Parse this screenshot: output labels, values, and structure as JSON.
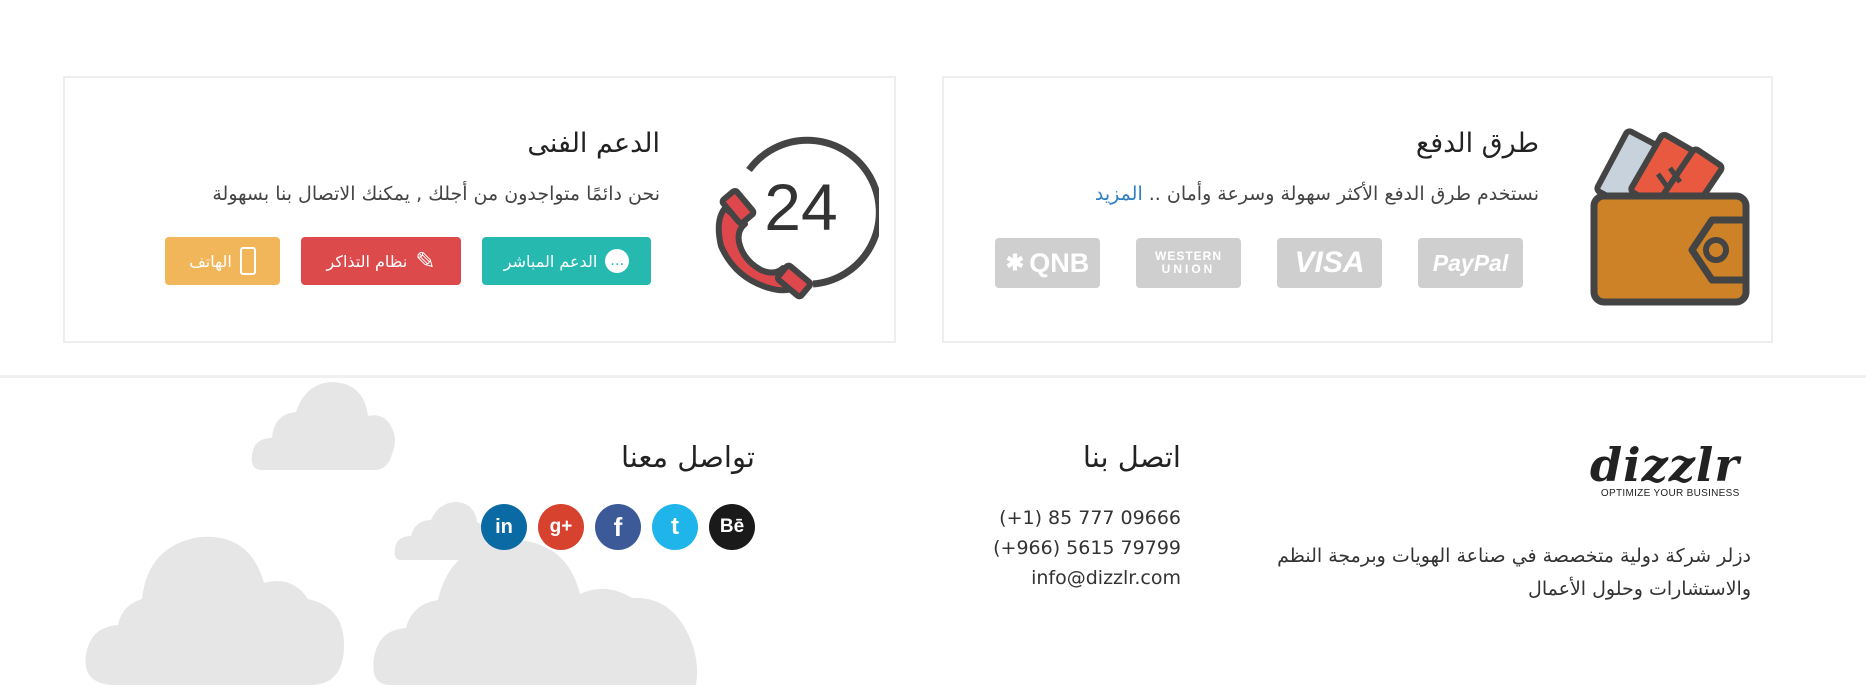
{
  "payment": {
    "title": "طرق الدفع",
    "description": "نستخدم طرق الدفع الأكثر سهولة وسرعة وأمان ..",
    "more_link": "المزيد",
    "icon": "wallet-icon",
    "logos": [
      {
        "name": "paypal",
        "label": "PayPal"
      },
      {
        "name": "visa",
        "label": "VISA"
      },
      {
        "name": "western-union",
        "label_line1": "WESTERN",
        "label_line2": "UNION"
      },
      {
        "name": "qnb",
        "label": "QNB"
      }
    ]
  },
  "support": {
    "title": "الدعم الفنى",
    "description": "نحن دائمًا متواجدون من أجلك , يمكنك الاتصال بنا بسهولة",
    "icon_number": "24",
    "buttons": {
      "live": "الدعم المباشر",
      "tickets": "نظام التذاكر",
      "phone": "الهاتف"
    },
    "colors": {
      "live": "#25b9b0",
      "tickets": "#dc4a4c",
      "phone": "#f2b65a"
    }
  },
  "footer": {
    "brand": {
      "name": "dizzlr",
      "tagline": "OPTIMIZE YOUR BUSINESS"
    },
    "about": "دزلر شركة دولية متخصصة في صناعة الهويات وبرمجة النظم والاستشارات وحلول الأعمال",
    "contact": {
      "title": "اتصل بنا",
      "phone1": "(+1) 85 777 09666",
      "phone2": "(+966) 5615 79799",
      "email": "info@dizzlr.com"
    },
    "social": {
      "title": "تواصل معنا",
      "items": [
        {
          "name": "behance",
          "glyph": "Bē",
          "color": "#1a1a1a"
        },
        {
          "name": "twitter",
          "glyph": "t",
          "color": "#1fb5ea"
        },
        {
          "name": "facebook",
          "glyph": "f",
          "color": "#3d5a98"
        },
        {
          "name": "google-plus",
          "glyph": "g+",
          "color": "#d6422e"
        },
        {
          "name": "linkedin",
          "glyph": "in",
          "color": "#0a6aa3"
        }
      ]
    }
  }
}
